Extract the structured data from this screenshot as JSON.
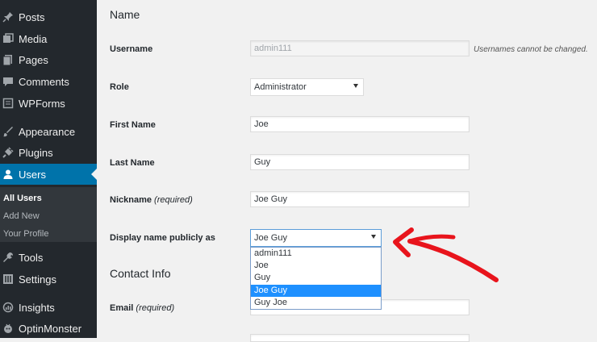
{
  "sidebar": {
    "items": [
      {
        "label": "Posts",
        "icon": "pin-icon"
      },
      {
        "label": "Media",
        "icon": "media-icon"
      },
      {
        "label": "Pages",
        "icon": "pages-icon"
      },
      {
        "label": "Comments",
        "icon": "comment-icon"
      },
      {
        "label": "WPForms",
        "icon": "wpforms-icon"
      },
      {
        "label": "Appearance",
        "icon": "brush-icon"
      },
      {
        "label": "Plugins",
        "icon": "plug-icon"
      },
      {
        "label": "Users",
        "icon": "user-icon",
        "active": true
      },
      {
        "label": "Tools",
        "icon": "wrench-icon"
      },
      {
        "label": "Settings",
        "icon": "settings-icon"
      },
      {
        "label": "Insights",
        "icon": "insights-icon"
      },
      {
        "label": "OptinMonster",
        "icon": "optinmonster-icon"
      }
    ],
    "submenu": [
      {
        "label": "All Users",
        "current": true
      },
      {
        "label": "Add New"
      },
      {
        "label": "Your Profile"
      }
    ]
  },
  "sections": {
    "name": "Name",
    "contact": "Contact Info"
  },
  "fields": {
    "username": {
      "label": "Username",
      "value": "admin111",
      "hint": "Usernames cannot be changed."
    },
    "role": {
      "label": "Role",
      "value": "Administrator"
    },
    "first_name": {
      "label": "First Name",
      "value": "Joe"
    },
    "last_name": {
      "label": "Last Name",
      "value": "Guy"
    },
    "nickname": {
      "label": "Nickname",
      "required": "(required)",
      "value": "Joe Guy"
    },
    "display_name": {
      "label": "Display name publicly as",
      "value": "Joe Guy",
      "options": [
        "admin111",
        "Joe",
        "Guy",
        "Joe Guy",
        "Guy Joe"
      ],
      "highlighted": "Joe Guy"
    },
    "email": {
      "label": "Email",
      "required": "(required)"
    }
  },
  "colors": {
    "sidebar": "#23282d",
    "accent": "#0073aa",
    "annotation_arrow": "#e8141c",
    "highlight": "#1e90ff"
  }
}
